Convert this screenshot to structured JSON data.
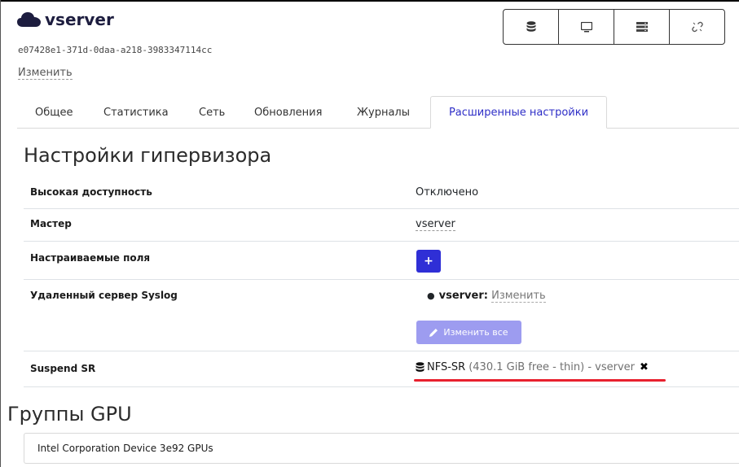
{
  "host": {
    "name": "vserver",
    "uuid": "e07428e1-371d-0daa-a218-3983347114cc",
    "edit_label": "Изменить",
    "icon": "cloud-icon"
  },
  "toolbar": {
    "buttons": [
      {
        "icon": "database-icon"
      },
      {
        "icon": "monitor-icon"
      },
      {
        "icon": "server-rack-icon"
      },
      {
        "icon": "unlink-icon"
      }
    ]
  },
  "tabs": [
    {
      "label": "Общее",
      "active": false
    },
    {
      "label": "Статистика",
      "active": false
    },
    {
      "label": "Сеть",
      "active": false
    },
    {
      "label": "Обновления",
      "active": false
    },
    {
      "label": "Журналы",
      "active": false
    },
    {
      "label": "Расширенные настройки",
      "active": true
    }
  ],
  "hypervisor": {
    "title": "Настройки гипервизора",
    "rows": {
      "ha": {
        "label": "Высокая доступность",
        "value": "Отключено"
      },
      "master": {
        "label": "Мастер",
        "value": "vserver"
      },
      "custom_fields": {
        "label": "Настраиваемые поля",
        "button": "+"
      },
      "syslog": {
        "label": "Удаленный сервер Syslog",
        "host": "vserver:",
        "host_edit": "Изменить",
        "edit_all": "Изменить все"
      },
      "suspend_sr": {
        "label": "Suspend SR",
        "sr_name": "NFS-SR",
        "sr_info": "(430.1 GiB free - thin) - vserver",
        "remove_glyph": "✖"
      }
    }
  },
  "gpu": {
    "title": "Группы GPU",
    "groups": [
      "Intel Corporation Device 3e92 GPUs"
    ]
  },
  "colors": {
    "accent": "#2f2fd6",
    "accent_disabled": "#9d9cf0",
    "active_tab_text": "#2e2ec7",
    "highlight_underline": "#e8202e"
  }
}
